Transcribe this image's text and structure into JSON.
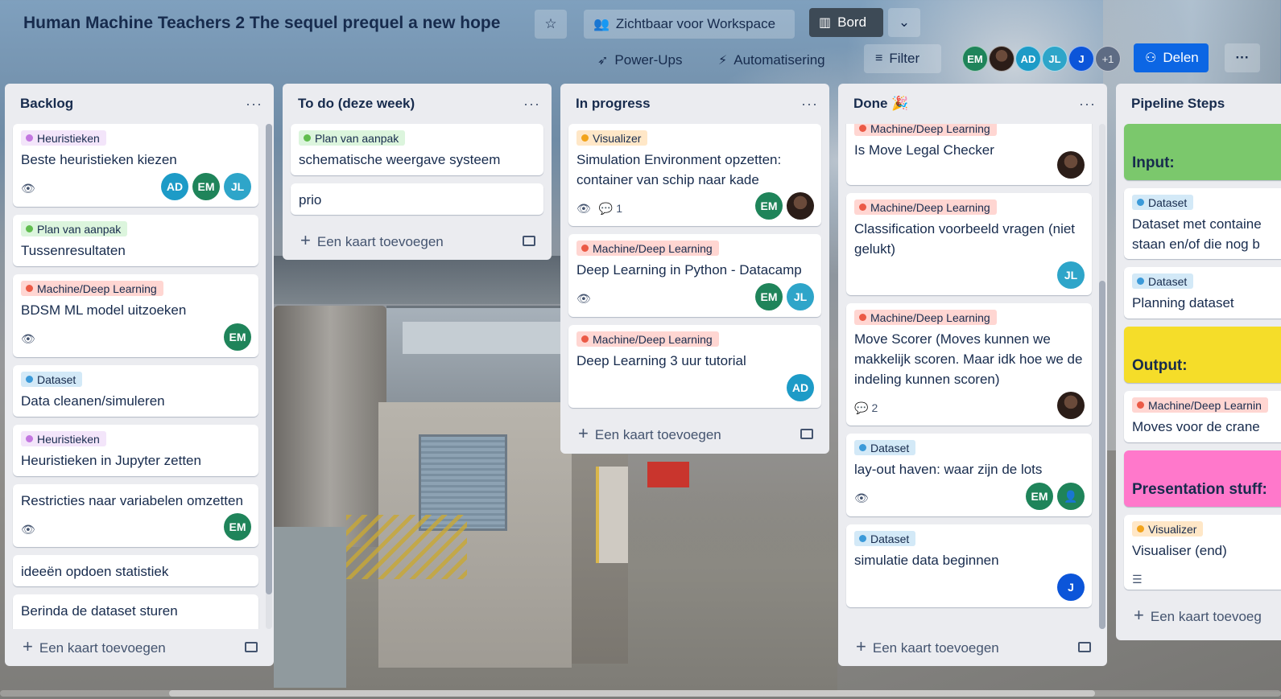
{
  "header": {
    "board_title": "Human Machine Teachers 2 The sequel prequel a new hope",
    "visibility_label": "Zichtbaar voor Workspace",
    "view_label": "Bord",
    "powerups_label": "Power-Ups",
    "automation_label": "Automatisering",
    "filter_label": "Filter",
    "share_label": "Delen",
    "more_members": "+1",
    "members": [
      "EM",
      "",
      "AD",
      "JL",
      "J"
    ]
  },
  "lists": [
    {
      "title": "Backlog",
      "add_label": "Een kaart toevoegen",
      "cards": [
        {
          "label": "Heuristieken",
          "title": "Beste heuristieken kiezen",
          "members": [
            "AD",
            "EM",
            "JL"
          ]
        },
        {
          "label": "Plan van aanpak",
          "title": "Tussenresultaten"
        },
        {
          "label": "Machine/Deep Learning",
          "title": "BDSM ML model uitzoeken",
          "members": [
            "EM"
          ]
        },
        {
          "label": "Dataset",
          "title": "Data cleanen/simuleren"
        },
        {
          "label": "Heuristieken",
          "title": "Heuristieken in Jupyter zetten"
        },
        {
          "title": "Restricties naar variabelen omzetten",
          "members": [
            "EM"
          ]
        },
        {
          "title": "ideeën opdoen statistiek"
        },
        {
          "title": "Berinda de dataset sturen"
        }
      ]
    },
    {
      "title": "To do (deze week)",
      "add_label": "Een kaart toevoegen",
      "cards": [
        {
          "label": "Plan van aanpak",
          "title": "schematische weergave systeem"
        },
        {
          "title": "prio"
        }
      ]
    },
    {
      "title": "In progress",
      "add_label": "Een kaart toevoegen",
      "cards": [
        {
          "label": "Visualizer",
          "title": "Simulation Environment opzetten: container van schip naar kade",
          "comments": "1",
          "members": [
            "EM"
          ]
        },
        {
          "label": "Machine/Deep Learning",
          "title": "Deep Learning in Python - Datacamp",
          "members": [
            "EM",
            "JL"
          ]
        },
        {
          "label": "Machine/Deep Learning",
          "title": "Deep Learning 3 uur tutorial",
          "members": [
            "AD"
          ]
        }
      ]
    },
    {
      "title": "Done 🎉",
      "add_label": "Een kaart toevoegen",
      "cards": [
        {
          "label": "Machine/Deep Learning",
          "title": "Is Move Legal Checker"
        },
        {
          "label": "Machine/Deep Learning",
          "title": "Classification voorbeeld vragen (niet gelukt)",
          "members": [
            "JL"
          ]
        },
        {
          "label": "Machine/Deep Learning",
          "title": "Move Scorer (Moves kunnen we makkelijk scoren. Maar idk hoe we de indeling kunnen scoren)",
          "comments": "2"
        },
        {
          "label": "Dataset",
          "title": "lay-out haven: waar zijn de lots",
          "members": [
            "EM"
          ]
        },
        {
          "label": "Dataset",
          "title": "simulatie data beginnen",
          "members": [
            "J"
          ]
        }
      ]
    },
    {
      "title": "Pipeline Steps",
      "add_label": "Een kaart toevoeg",
      "cards": [
        {
          "cover_title": "Input:"
        },
        {
          "label": "Dataset",
          "title": "Dataset met containe staan en/of die nog b"
        },
        {
          "label": "Dataset",
          "title": "Planning dataset"
        },
        {
          "cover_title": "Output:"
        },
        {
          "label": "Machine/Deep Learnin",
          "title": "Moves voor de crane"
        },
        {
          "cover_title": "Presentation stuff:"
        },
        {
          "label": "Visualizer",
          "title": "Visualiser (end)"
        }
      ]
    }
  ],
  "colors": {
    "label_heuristieken": "#c377e0",
    "label_plan": "#61bd4f",
    "label_ml": "#eb5a46",
    "label_dataset": "#3b9ad9",
    "label_visualizer": "#f2a41c",
    "cover_input": "#7bc86c",
    "cover_output": "#f5dd29",
    "cover_presentation": "#ff78cb",
    "share_button": "#0c66e4"
  }
}
